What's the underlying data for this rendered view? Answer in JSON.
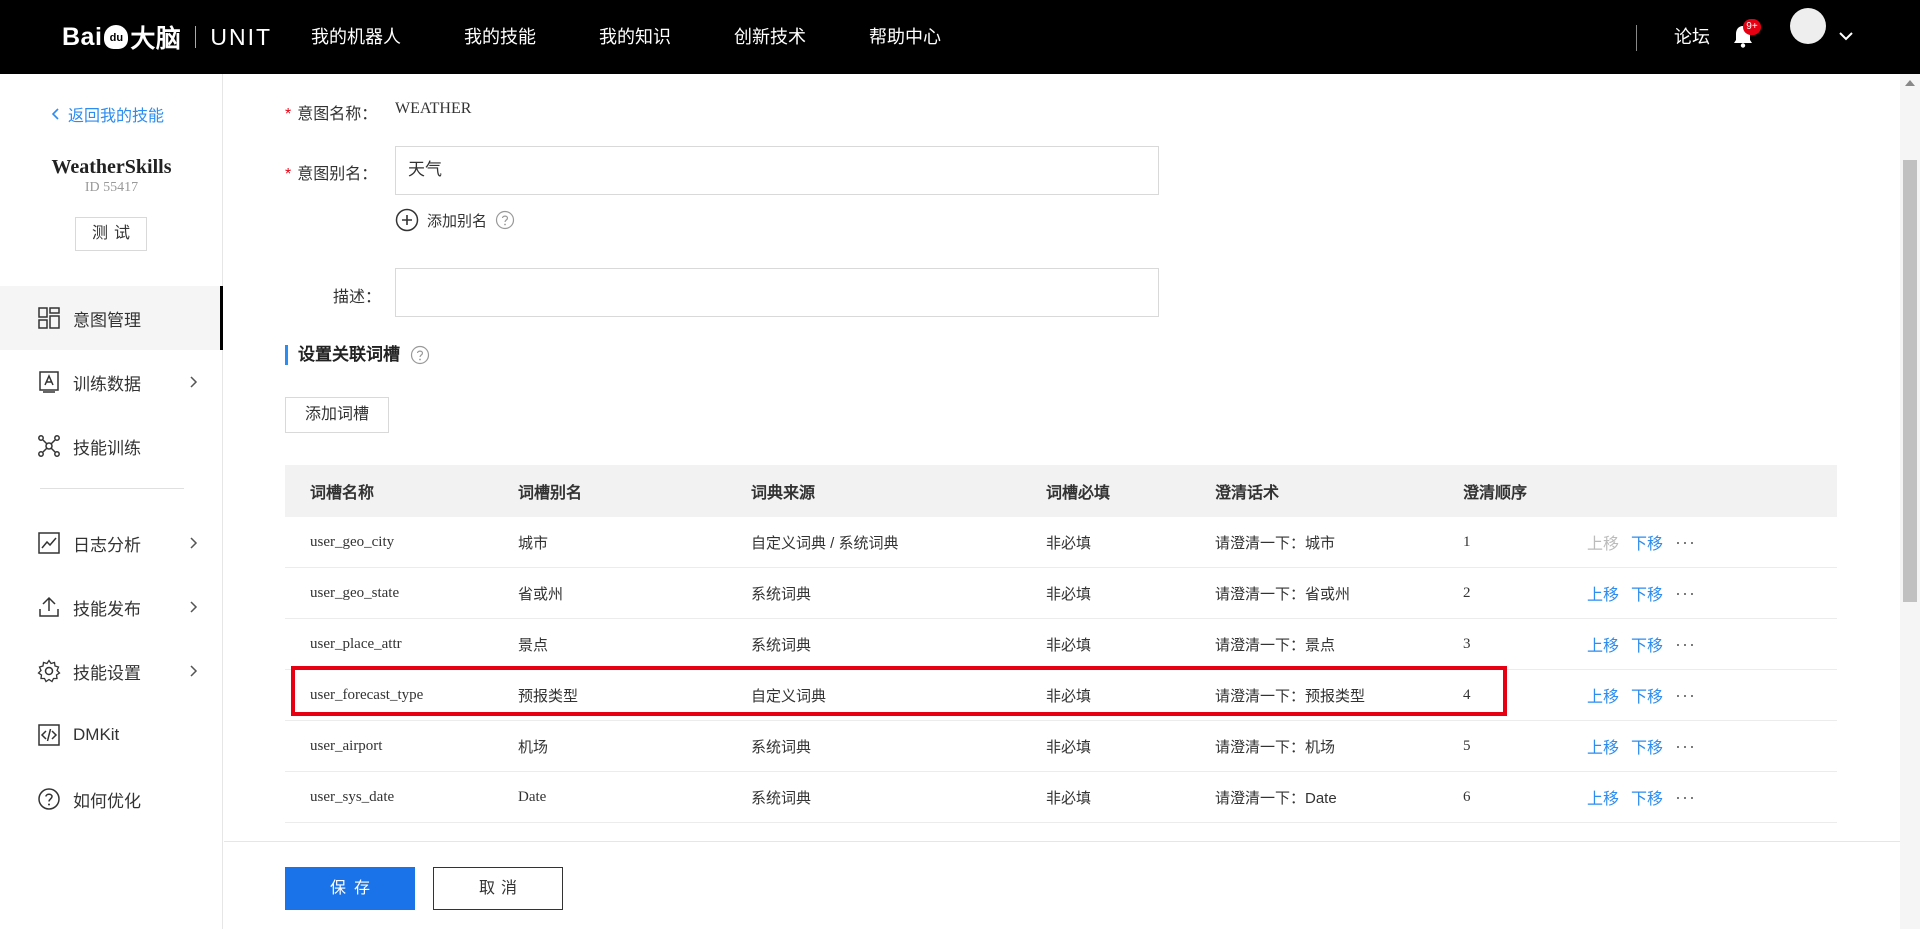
{
  "header": {
    "logo_brand_a": "Bai",
    "logo_brand_paw": "du",
    "logo_brand_b": "大脑",
    "logo_unit": "UNIT",
    "nav": [
      "我的机器人",
      "我的技能",
      "我的知识",
      "创新技术",
      "帮助中心"
    ],
    "forum": "论坛",
    "badge": "9+"
  },
  "sidebar": {
    "back": "返回我的技能",
    "skill_name": "WeatherSkills",
    "skill_id": "ID 55417",
    "test": "测试",
    "items": [
      {
        "label": "意图管理",
        "icon": "grid-icon"
      },
      {
        "label": "训练数据",
        "icon": "document-a-icon"
      },
      {
        "label": "技能训练",
        "icon": "network-icon"
      },
      {
        "label": "日志分析",
        "icon": "chart-icon"
      },
      {
        "label": "技能发布",
        "icon": "upload-icon"
      },
      {
        "label": "技能设置",
        "icon": "gear-icon"
      },
      {
        "label": "DMKit",
        "icon": "code-icon"
      },
      {
        "label": "如何优化",
        "icon": "question-icon"
      }
    ]
  },
  "form": {
    "intent_name_label": "意图名称：",
    "intent_name_value": "WEATHER",
    "alias_label": "意图别名：",
    "alias_value": "天气",
    "add_alias": "添加别名",
    "desc_label": "描述："
  },
  "slots": {
    "section_title": "设置关联词槽",
    "add_slot": "添加词槽",
    "columns": [
      "词槽名称",
      "词槽别名",
      "词典来源",
      "词槽必填",
      "澄清话术",
      "澄清顺序"
    ],
    "rows": [
      {
        "name": "user_geo_city",
        "alias": "城市",
        "source": "自定义词典 / 系统词典",
        "required": "非必填",
        "clarify": "请澄清一下：城市",
        "order": "1"
      },
      {
        "name": "user_geo_state",
        "alias": "省或州",
        "source": "系统词典",
        "required": "非必填",
        "clarify": "请澄清一下：省或州",
        "order": "2"
      },
      {
        "name": "user_place_attr",
        "alias": "景点",
        "source": "系统词典",
        "required": "非必填",
        "clarify": "请澄清一下：景点",
        "order": "3"
      },
      {
        "name": "user_forecast_type",
        "alias": "预报类型",
        "source": "自定义词典",
        "required": "非必填",
        "clarify": "请澄清一下：预报类型",
        "order": "4"
      },
      {
        "name": "user_airport",
        "alias": "机场",
        "source": "系统词典",
        "required": "非必填",
        "clarify": "请澄清一下：机场",
        "order": "5"
      },
      {
        "name": "user_sys_date",
        "alias": "Date",
        "source": "系统词典",
        "required": "非必填",
        "clarify": "请澄清一下：Date",
        "order": "6"
      }
    ],
    "move_up": "上移",
    "move_down": "下移",
    "more": "···"
  },
  "footer": {
    "save": "保存",
    "cancel": "取消"
  },
  "colors": {
    "accent": "#2d8cf0",
    "primary_button": "#1a73e8",
    "highlight": "#e60012",
    "header_bg": "#000000"
  }
}
